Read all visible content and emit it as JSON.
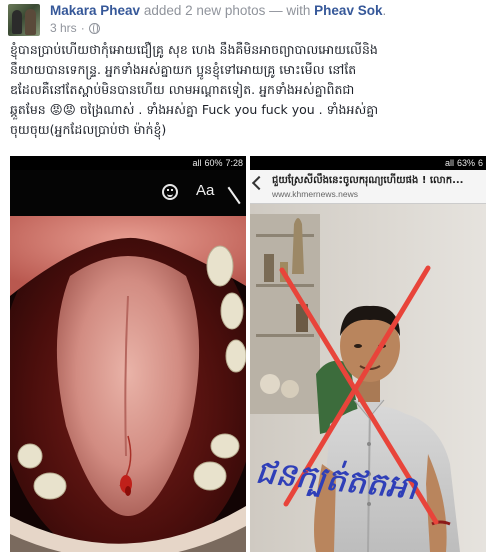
{
  "post": {
    "author": "Makara Pheav",
    "action": " added 2 new photos — with ",
    "tagged": "Pheav Sok",
    "tagged_suffix": ".",
    "time": "3 hrs",
    "separator": "·",
    "privacy_icon": "globe-icon",
    "text_lines": [
      "ខ្ញុំបានប្រាប់ហើយថាកុំអោយជឿគ្រូ សុខ ហេង នឹងគឺមិនអាចព្យាបាលអោយលើនិង",
      "នឹយាយបានទេកន្រ្ទ. អ្នកទាំងអស់គ្នាយក ប្អូនខ្ញុំទៅអោយគ្រូ មោះមើល នៅតែ",
      "ឌ‌ដែលគឺនៅតែស្ពាប់មិនបានហើយ លាមអណ្ដាតទៀត. អ្នកទាំងអស់គ្នាពិតជា",
      "ឆ្កួតមែន 😡😡 ចង្រៃណាស់ . ទាំងអស់គ្នា Fuck you fuck you . ទាំងអស់គ្នា",
      "ចុយចុយ(អ្នកដែលប្រាប់ថា ម៉ាក់ខ្ញុំ)"
    ]
  },
  "photo_left": {
    "status": {
      "signal": "all",
      "battery": "60%",
      "time": "7:28"
    },
    "toolbar": {
      "emoji_icon": "smiley-icon",
      "text_button": "Aa",
      "pen_icon": "pen-icon"
    }
  },
  "photo_right": {
    "status": {
      "signal": "all",
      "battery": "63%",
      "time": "6"
    },
    "site_title": "ជួយស្រែសីលឹងនេះចូលករុណ្យហើយផង ! លោក...",
    "site_url": "www.khmernews.news",
    "handwriting": "ជនក្បត់ឥតអា"
  }
}
